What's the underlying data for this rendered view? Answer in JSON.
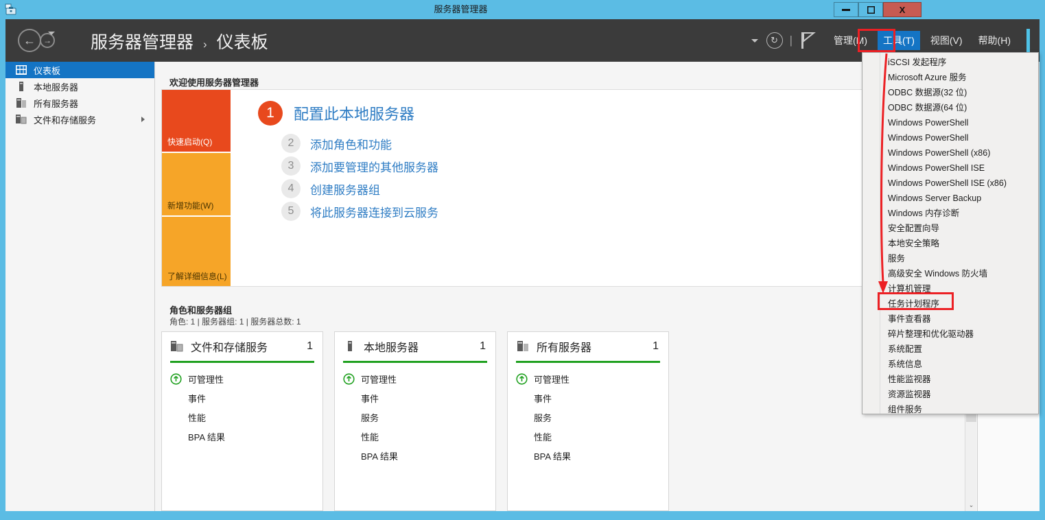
{
  "window": {
    "title": "服务器管理器",
    "icon": "server-manager-icon",
    "minimize_label": "—",
    "maximize_label": "❐",
    "close_label": "X",
    "titlebar_color": "#5bbce4"
  },
  "toolbar": {
    "breadcrumb_root": "服务器管理器",
    "breadcrumb_sep": "›",
    "breadcrumb_leaf": "仪表板",
    "back_icon": "arrow-left-icon",
    "forward_icon": "arrow-right-icon",
    "history_chevron_icon": "chevron-down-icon",
    "refresh_icon": "refresh-icon",
    "separator": "|",
    "flag_icon": "flag-icon",
    "menus": [
      {
        "label": "管理(M)",
        "active": false
      },
      {
        "label": "工具(T)",
        "active": true
      },
      {
        "label": "视图(V)",
        "active": false
      },
      {
        "label": "帮助(H)",
        "active": false
      }
    ],
    "accent_color": "#4fc3e8",
    "active_menu_bg": "#1474c4"
  },
  "sidebar": {
    "items": [
      {
        "label": "仪表板",
        "icon": "dashboard-icon",
        "selected": true,
        "chevron": false
      },
      {
        "label": "本地服务器",
        "icon": "local-server-icon",
        "selected": false,
        "chevron": false
      },
      {
        "label": "所有服务器",
        "icon": "all-servers-icon",
        "selected": false,
        "chevron": false
      },
      {
        "label": "文件和存储服务",
        "icon": "file-storage-icon",
        "selected": false,
        "chevron": true
      }
    ],
    "selected_color": "#1474c4"
  },
  "main": {
    "welcome_heading": "欢迎使用服务器管理器",
    "tiles": [
      {
        "label": "快速启动(Q)",
        "color": "#e8491d"
      },
      {
        "label": "新增功能(W)",
        "color": "#f6a528"
      },
      {
        "label": "了解详细信息(L)",
        "color": "#f6a528"
      }
    ],
    "steps": [
      {
        "num": "1",
        "label": "配置此本地服务器",
        "primary": true
      },
      {
        "num": "2",
        "label": "添加角色和功能",
        "primary": false
      },
      {
        "num": "3",
        "label": "添加要管理的其他服务器",
        "primary": false
      },
      {
        "num": "4",
        "label": "创建服务器组",
        "primary": false
      },
      {
        "num": "5",
        "label": "将此服务器连接到云服务",
        "primary": false
      }
    ],
    "roles_heading": "角色和服务器组",
    "roles_summary": "角色: 1 | 服务器组: 1 | 服务器总数: 1",
    "cards": [
      {
        "title": "文件和存储服务",
        "count": "1",
        "icon": "file-storage-icon",
        "rows": [
          {
            "label": "可管理性",
            "icon": "manageability-up-icon"
          },
          {
            "label": "事件",
            "icon": ""
          },
          {
            "label": "性能",
            "icon": ""
          },
          {
            "label": "BPA 结果",
            "icon": ""
          }
        ]
      },
      {
        "title": "本地服务器",
        "count": "1",
        "icon": "local-server-icon",
        "rows": [
          {
            "label": "可管理性",
            "icon": "manageability-up-icon"
          },
          {
            "label": "事件",
            "icon": ""
          },
          {
            "label": "服务",
            "icon": ""
          },
          {
            "label": "性能",
            "icon": ""
          },
          {
            "label": "BPA 结果",
            "icon": ""
          }
        ]
      },
      {
        "title": "所有服务器",
        "count": "1",
        "icon": "all-servers-icon",
        "rows": [
          {
            "label": "可管理性",
            "icon": "manageability-up-icon"
          },
          {
            "label": "事件",
            "icon": ""
          },
          {
            "label": "服务",
            "icon": ""
          },
          {
            "label": "性能",
            "icon": ""
          },
          {
            "label": "BPA 结果",
            "icon": ""
          }
        ]
      }
    ],
    "status_rule_color": "#21a121",
    "scrollbar": {
      "up_arrow": "⌃",
      "down_arrow": "⌄"
    }
  },
  "tools_menu": {
    "items": [
      {
        "label": "iSCSI 发起程序",
        "highlighted": false
      },
      {
        "label": "Microsoft Azure 服务",
        "highlighted": false
      },
      {
        "label": "ODBC 数据源(32 位)",
        "highlighted": false
      },
      {
        "label": "ODBC 数据源(64 位)",
        "highlighted": false
      },
      {
        "label": "Windows PowerShell",
        "highlighted": false
      },
      {
        "label": "Windows PowerShell",
        "highlighted": false
      },
      {
        "label": "Windows PowerShell (x86)",
        "highlighted": false
      },
      {
        "label": "Windows PowerShell ISE",
        "highlighted": false
      },
      {
        "label": "Windows PowerShell ISE (x86)",
        "highlighted": false
      },
      {
        "label": "Windows Server Backup",
        "highlighted": false
      },
      {
        "label": "Windows 内存诊断",
        "highlighted": false
      },
      {
        "label": "安全配置向导",
        "highlighted": false
      },
      {
        "label": "本地安全策略",
        "highlighted": false
      },
      {
        "label": "服务",
        "highlighted": false
      },
      {
        "label": "高级安全 Windows 防火墙",
        "highlighted": false
      },
      {
        "label": "计算机管理",
        "highlighted": false
      },
      {
        "label": "任务计划程序",
        "highlighted": true
      },
      {
        "label": "事件查看器",
        "highlighted": false
      },
      {
        "label": "碎片整理和优化驱动器",
        "highlighted": false
      },
      {
        "label": "系统配置",
        "highlighted": false
      },
      {
        "label": "系统信息",
        "highlighted": false
      },
      {
        "label": "性能监视器",
        "highlighted": false
      },
      {
        "label": "资源监视器",
        "highlighted": false
      },
      {
        "label": "组件服务",
        "highlighted": false
      }
    ]
  },
  "annotations": {
    "highlight_color": "#ec2024",
    "boxes": [
      {
        "name": "tools-menu-button-highlight"
      },
      {
        "name": "task-scheduler-item-highlight"
      }
    ],
    "arrow": {
      "name": "pointer-arrow",
      "from": "工具(T)",
      "to": "任务计划程序"
    }
  }
}
